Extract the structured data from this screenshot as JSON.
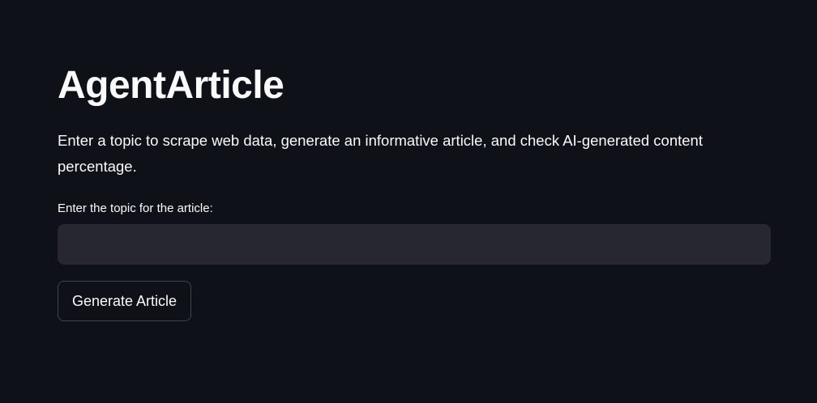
{
  "page": {
    "title": "AgentArticle",
    "description": "Enter a topic to scrape web data, generate an informative article, and check AI-generated content percentage."
  },
  "form": {
    "topic_label": "Enter the topic for the article:",
    "topic_value": "",
    "topic_placeholder": "",
    "generate_button_label": "Generate Article"
  },
  "colors": {
    "background": "#0e1117",
    "input_background": "#262730",
    "text": "#fafafa"
  }
}
